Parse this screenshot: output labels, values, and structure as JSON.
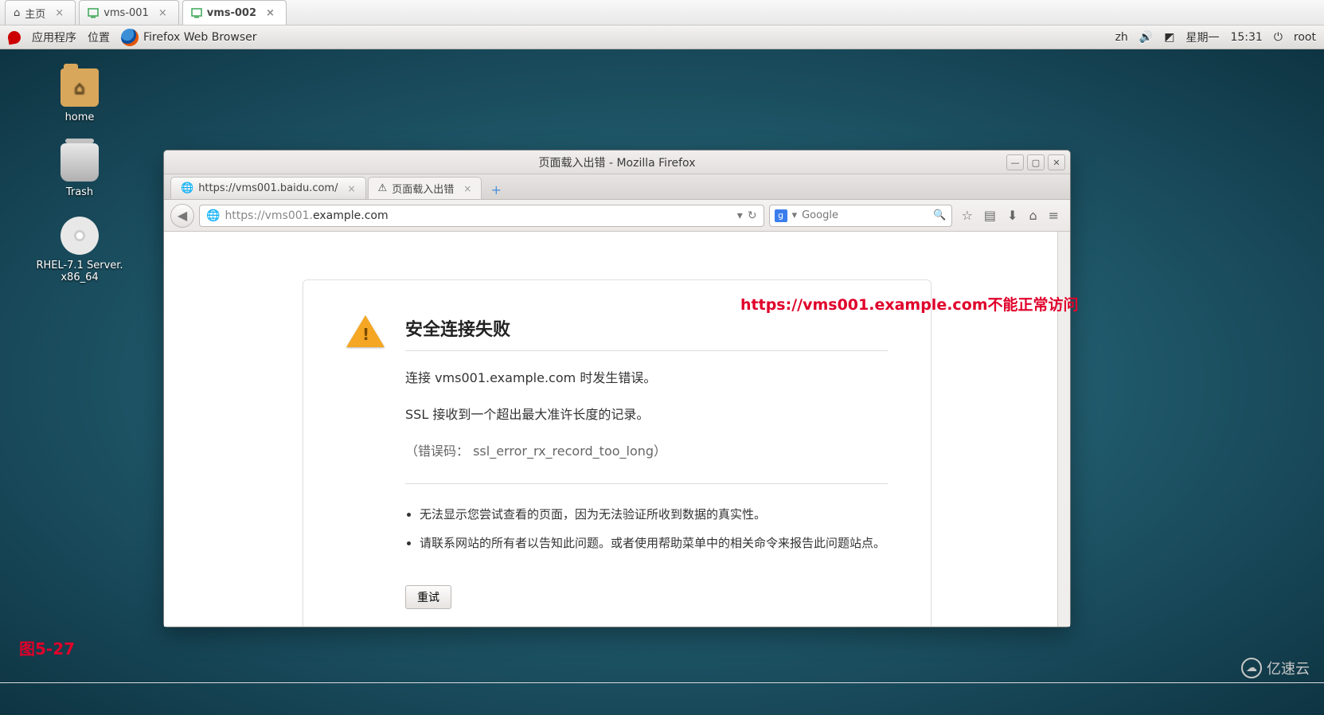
{
  "vm_tabs": [
    {
      "label": "主页",
      "icon": "home"
    },
    {
      "label": "vms-001",
      "icon": "vm"
    },
    {
      "label": "vms-002",
      "icon": "vm",
      "active": true
    }
  ],
  "panel": {
    "apps": "应用程序",
    "places": "位置",
    "running": "Firefox Web Browser",
    "lang": "zh",
    "day": "星期一",
    "time": "15:31",
    "user": "root"
  },
  "desktop_icons": {
    "home": "home",
    "trash": "Trash",
    "disc": "RHEL-7.1 Server. x86_64"
  },
  "window": {
    "title": "页面载入出错  -  Mozilla Firefox",
    "controls": {
      "min": "—",
      "max": "▢",
      "close": "✕"
    }
  },
  "firefox_tabs": [
    {
      "label": "https://vms001.baidu.com/",
      "icon": "globe"
    },
    {
      "label": "页面载入出错",
      "icon": "warn",
      "active": true
    }
  ],
  "newtab": "+",
  "url": {
    "scheme": "https://vms001.",
    "host": "example.com"
  },
  "urlbar_icons": {
    "dropdown": "▾",
    "reload": "↻"
  },
  "search": {
    "engine": "g",
    "placeholder": "Google"
  },
  "nav_icons": {
    "bookmark": "☆",
    "sidebar": "▤",
    "downloads": "⬇",
    "home": "⌂",
    "menu": "≡"
  },
  "error": {
    "heading": "安全连接失败",
    "line1": "连接 vms001.example.com 时发生错误。",
    "line2": "SSL 接收到一个超出最大准许长度的记录。",
    "code": "（错误码： ssl_error_rx_record_too_long）",
    "bullets": [
      "无法显示您尝试查看的页面，因为无法验证所收到数据的真实性。",
      "请联系网站的所有者以告知此问题。或者使用帮助菜单中的相关命令来报告此问题站点。"
    ],
    "retry": "重试"
  },
  "overlay": "https://vms001.example.com不能正常访问",
  "figure": "图5-27",
  "watermark": "亿速云"
}
